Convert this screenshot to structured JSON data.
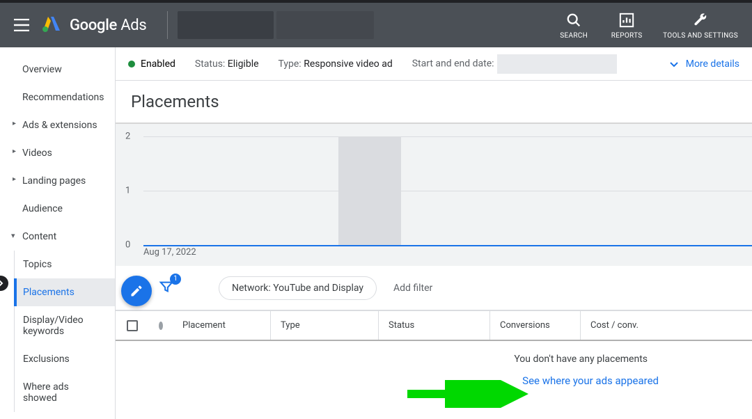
{
  "header": {
    "product_name_strong": "Google",
    "product_name_light": "Ads",
    "actions": {
      "search": "SEARCH",
      "reports": "REPORTS",
      "tools": "TOOLS AND SETTINGS"
    }
  },
  "sidebar": {
    "items": [
      {
        "label": "Overview",
        "expandable": false
      },
      {
        "label": "Recommendations",
        "expandable": false
      },
      {
        "label": "Ads & extensions",
        "expandable": true
      },
      {
        "label": "Videos",
        "expandable": true
      },
      {
        "label": "Landing pages",
        "expandable": true
      },
      {
        "label": "Audience",
        "expandable": false
      },
      {
        "label": "Content",
        "expandable": true,
        "expanded": true
      }
    ],
    "content_children": [
      {
        "label": "Topics"
      },
      {
        "label": "Placements",
        "active": true
      },
      {
        "label": "Display/Video keywords"
      },
      {
        "label": "Exclusions"
      },
      {
        "label": "Where ads showed"
      }
    ]
  },
  "status_bar": {
    "enabled_label": "Enabled",
    "status_label": "Status:",
    "status_value": "Eligible",
    "type_label": "Type:",
    "type_value": "Responsive video ad",
    "dates_label": "Start and end date:",
    "more_details": "More details"
  },
  "page": {
    "title": "Placements"
  },
  "chart_data": {
    "type": "bar",
    "categories": [
      "Aug 17, 2022"
    ],
    "values": [
      0
    ],
    "ylim": [
      0,
      2
    ],
    "yticks": [
      0,
      1,
      2
    ],
    "x_start_label": "Aug 17, 2022"
  },
  "filters": {
    "badge_count": "1",
    "chip": "Network: YouTube and Display",
    "add_filter": "Add filter"
  },
  "table": {
    "columns": [
      "Placement",
      "Type",
      "Status",
      "Conversions",
      "Cost / conv."
    ]
  },
  "empty_state": {
    "message": "You don't have any placements",
    "link": "See where your ads appeared"
  }
}
